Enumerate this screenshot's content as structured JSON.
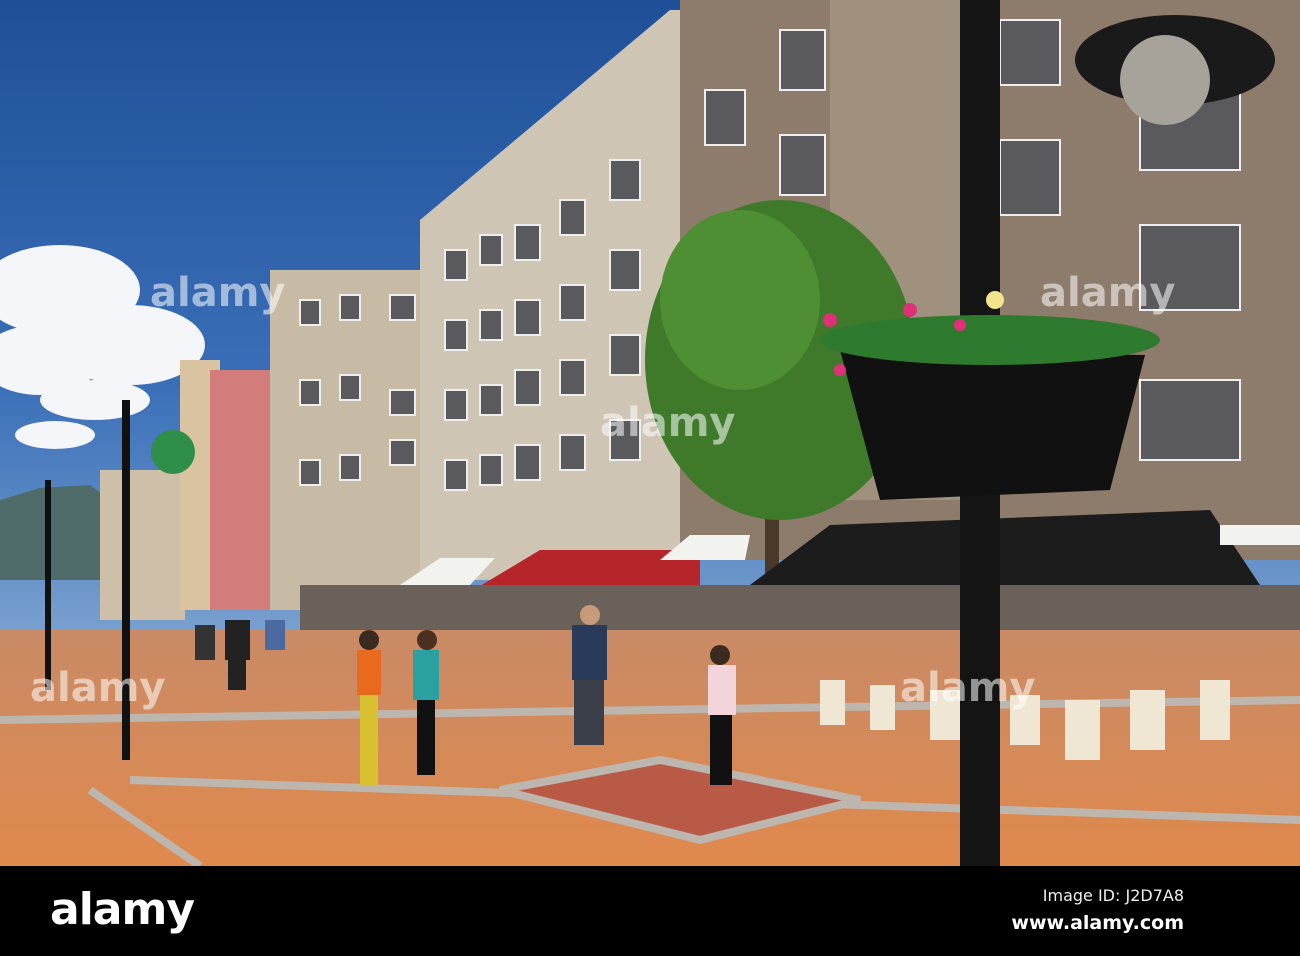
{
  "photo": {
    "subject": "pedestrian street",
    "colors": {
      "sky": "#2f5fa8",
      "pavement": "#d98a55",
      "building": "#c9bfae",
      "awning_red": "#b5252a",
      "awning_black": "#1c1c1c"
    }
  },
  "watermark": {
    "text": "alamy"
  },
  "footer": {
    "logo": "alamy",
    "image_id": "Image ID: J2D7A8",
    "website": "www.alamy.com"
  }
}
